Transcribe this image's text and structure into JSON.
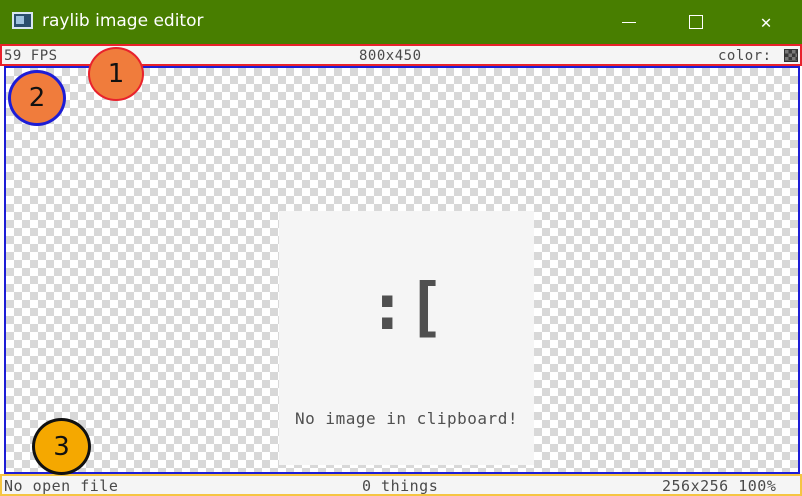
{
  "window": {
    "title": "raylib image editor",
    "minimize_icon": "minimize-icon",
    "maximize_icon": "maximize-icon",
    "close_icon": "close-icon",
    "close_glyph": "✕"
  },
  "top_bar": {
    "fps": "59 FPS",
    "resolution": "800x450",
    "color_label": "color:"
  },
  "canvas": {
    "emoticon": ":[",
    "message": "No image in clipboard!"
  },
  "bottom_bar": {
    "file_status": "No open file",
    "things": "0 things",
    "image_info": "256x256 100%"
  },
  "markers": [
    "1",
    "2",
    "3"
  ],
  "colors": {
    "titlebar": "#487e00",
    "top_bar_border": "#e8222c",
    "canvas_border": "#1d1dd6",
    "bottom_bar_border": "#f5c542"
  }
}
